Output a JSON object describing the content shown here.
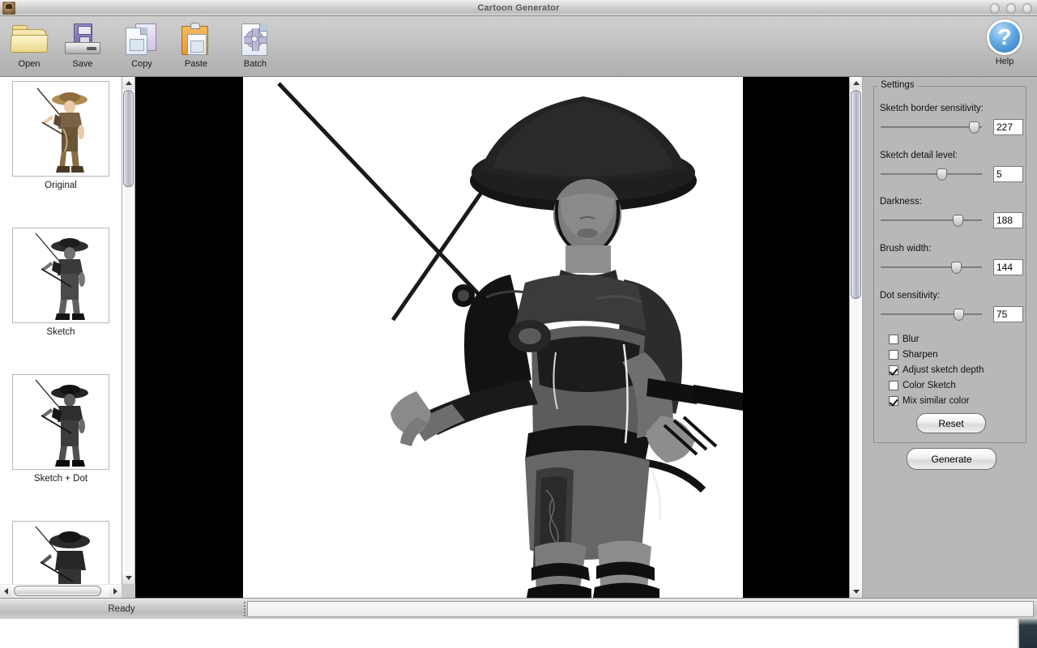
{
  "window": {
    "title": "Cartoon Generator",
    "app_icon": "app-icon",
    "controls": [
      "minimize-button",
      "maximize-button",
      "close-button"
    ]
  },
  "toolbar": {
    "buttons": [
      {
        "label": "Open",
        "icon": "folder-icon"
      },
      {
        "label": "Save",
        "icon": "floppy-disk-icon"
      },
      {
        "label": "Copy",
        "icon": "copy-pages-icon"
      },
      {
        "label": "Paste",
        "icon": "clipboard-icon"
      },
      {
        "label": "Batch",
        "icon": "gear-page-icon"
      }
    ],
    "help": {
      "label": "Help",
      "icon": "question-mark-icon",
      "glyph": "?"
    }
  },
  "sidebar": {
    "items": [
      {
        "label": "Original",
        "style": "color"
      },
      {
        "label": "Sketch",
        "style": "gray"
      },
      {
        "label": "Sketch + Dot",
        "style": "dot"
      },
      {
        "label": "",
        "style": "dense"
      }
    ],
    "vertical_scrollbar": {
      "thumb_top_pct": 2,
      "thumb_height_pct": 22
    },
    "horizontal_scrollbar": {
      "thumb_left_pct": 2,
      "thumb_width_pct": 80
    }
  },
  "canvas": {
    "background_color": "#000000",
    "image_background": "#ffffff",
    "vertical_scrollbar": {
      "thumb_top_pct": 2,
      "thumb_height_pct": 42
    }
  },
  "settings": {
    "group_title": "Settings",
    "sliders": [
      {
        "label": "Sketch border sensitivity:",
        "value": "227",
        "fill_pct": 92
      },
      {
        "label": "Sketch detail level:",
        "value": "5",
        "fill_pct": 58
      },
      {
        "label": "Darkness:",
        "value": "188",
        "fill_pct": 75
      },
      {
        "label": "Brush width:",
        "value": "144",
        "fill_pct": 74
      },
      {
        "label": "Dot sensitivity:",
        "value": "75",
        "fill_pct": 76
      }
    ],
    "checkboxes": [
      {
        "label": "Blur",
        "checked": false
      },
      {
        "label": "Sharpen",
        "checked": false
      },
      {
        "label": "Adjust sketch depth",
        "checked": true
      },
      {
        "label": "Color Sketch",
        "checked": false
      },
      {
        "label": "Mix similar color",
        "checked": true
      }
    ],
    "reset_label": "Reset",
    "generate_label": "Generate"
  },
  "statusbar": {
    "message": "Ready",
    "secondary": ""
  }
}
